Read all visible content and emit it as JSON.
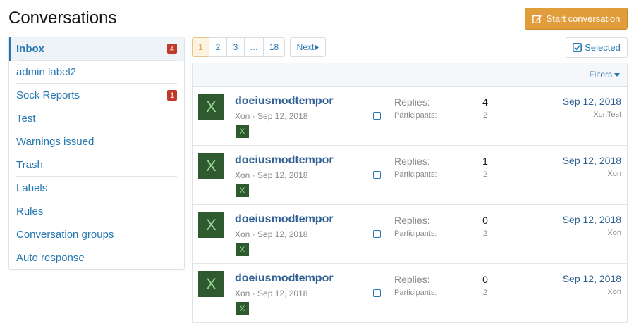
{
  "header": {
    "title": "Conversations",
    "start_label": "Start conversation"
  },
  "sidebar": {
    "items": [
      {
        "label": "Inbox",
        "badge": "4"
      },
      {
        "label": "admin label2",
        "badge": ""
      },
      {
        "label": "Sock Reports",
        "badge": "1"
      },
      {
        "label": "Test",
        "badge": ""
      },
      {
        "label": "Warnings issued",
        "badge": ""
      },
      {
        "label": "Trash",
        "badge": ""
      },
      {
        "label": "Labels",
        "badge": ""
      },
      {
        "label": "Rules",
        "badge": ""
      },
      {
        "label": "Conversation groups",
        "badge": ""
      },
      {
        "label": "Auto response",
        "badge": ""
      }
    ]
  },
  "pagination": {
    "pages": [
      "1",
      "2",
      "3",
      "…",
      "18"
    ],
    "current": "1",
    "next_label": "Next"
  },
  "toolbar": {
    "selected_label": "Selected",
    "filters_label": "Filters"
  },
  "labels": {
    "replies": "Replies:",
    "participants": "Participants:"
  },
  "conversations": [
    {
      "avatar": "X",
      "title": "doeiusmodtempor",
      "starter": "Xon",
      "started": "Sep 12, 2018",
      "replies": "4",
      "participants": "2",
      "last_date": "Sep 12, 2018",
      "last_user": "XonTest"
    },
    {
      "avatar": "X",
      "title": "doeiusmodtempor",
      "starter": "Xon",
      "started": "Sep 12, 2018",
      "replies": "1",
      "participants": "2",
      "last_date": "Sep 12, 2018",
      "last_user": "Xon"
    },
    {
      "avatar": "X",
      "title": "doeiusmodtempor",
      "starter": "Xon",
      "started": "Sep 12, 2018",
      "replies": "0",
      "participants": "2",
      "last_date": "Sep 12, 2018",
      "last_user": "Xon"
    },
    {
      "avatar": "X",
      "title": "doeiusmodtempor",
      "starter": "Xon",
      "started": "Sep 12, 2018",
      "replies": "0",
      "participants": "2",
      "last_date": "Sep 12, 2018",
      "last_user": "Xon"
    }
  ],
  "colors": {
    "accent": "#2577b1",
    "button": "#e29d3b",
    "badge": "#c0392b",
    "avatar_bg": "#2f5a2f"
  }
}
